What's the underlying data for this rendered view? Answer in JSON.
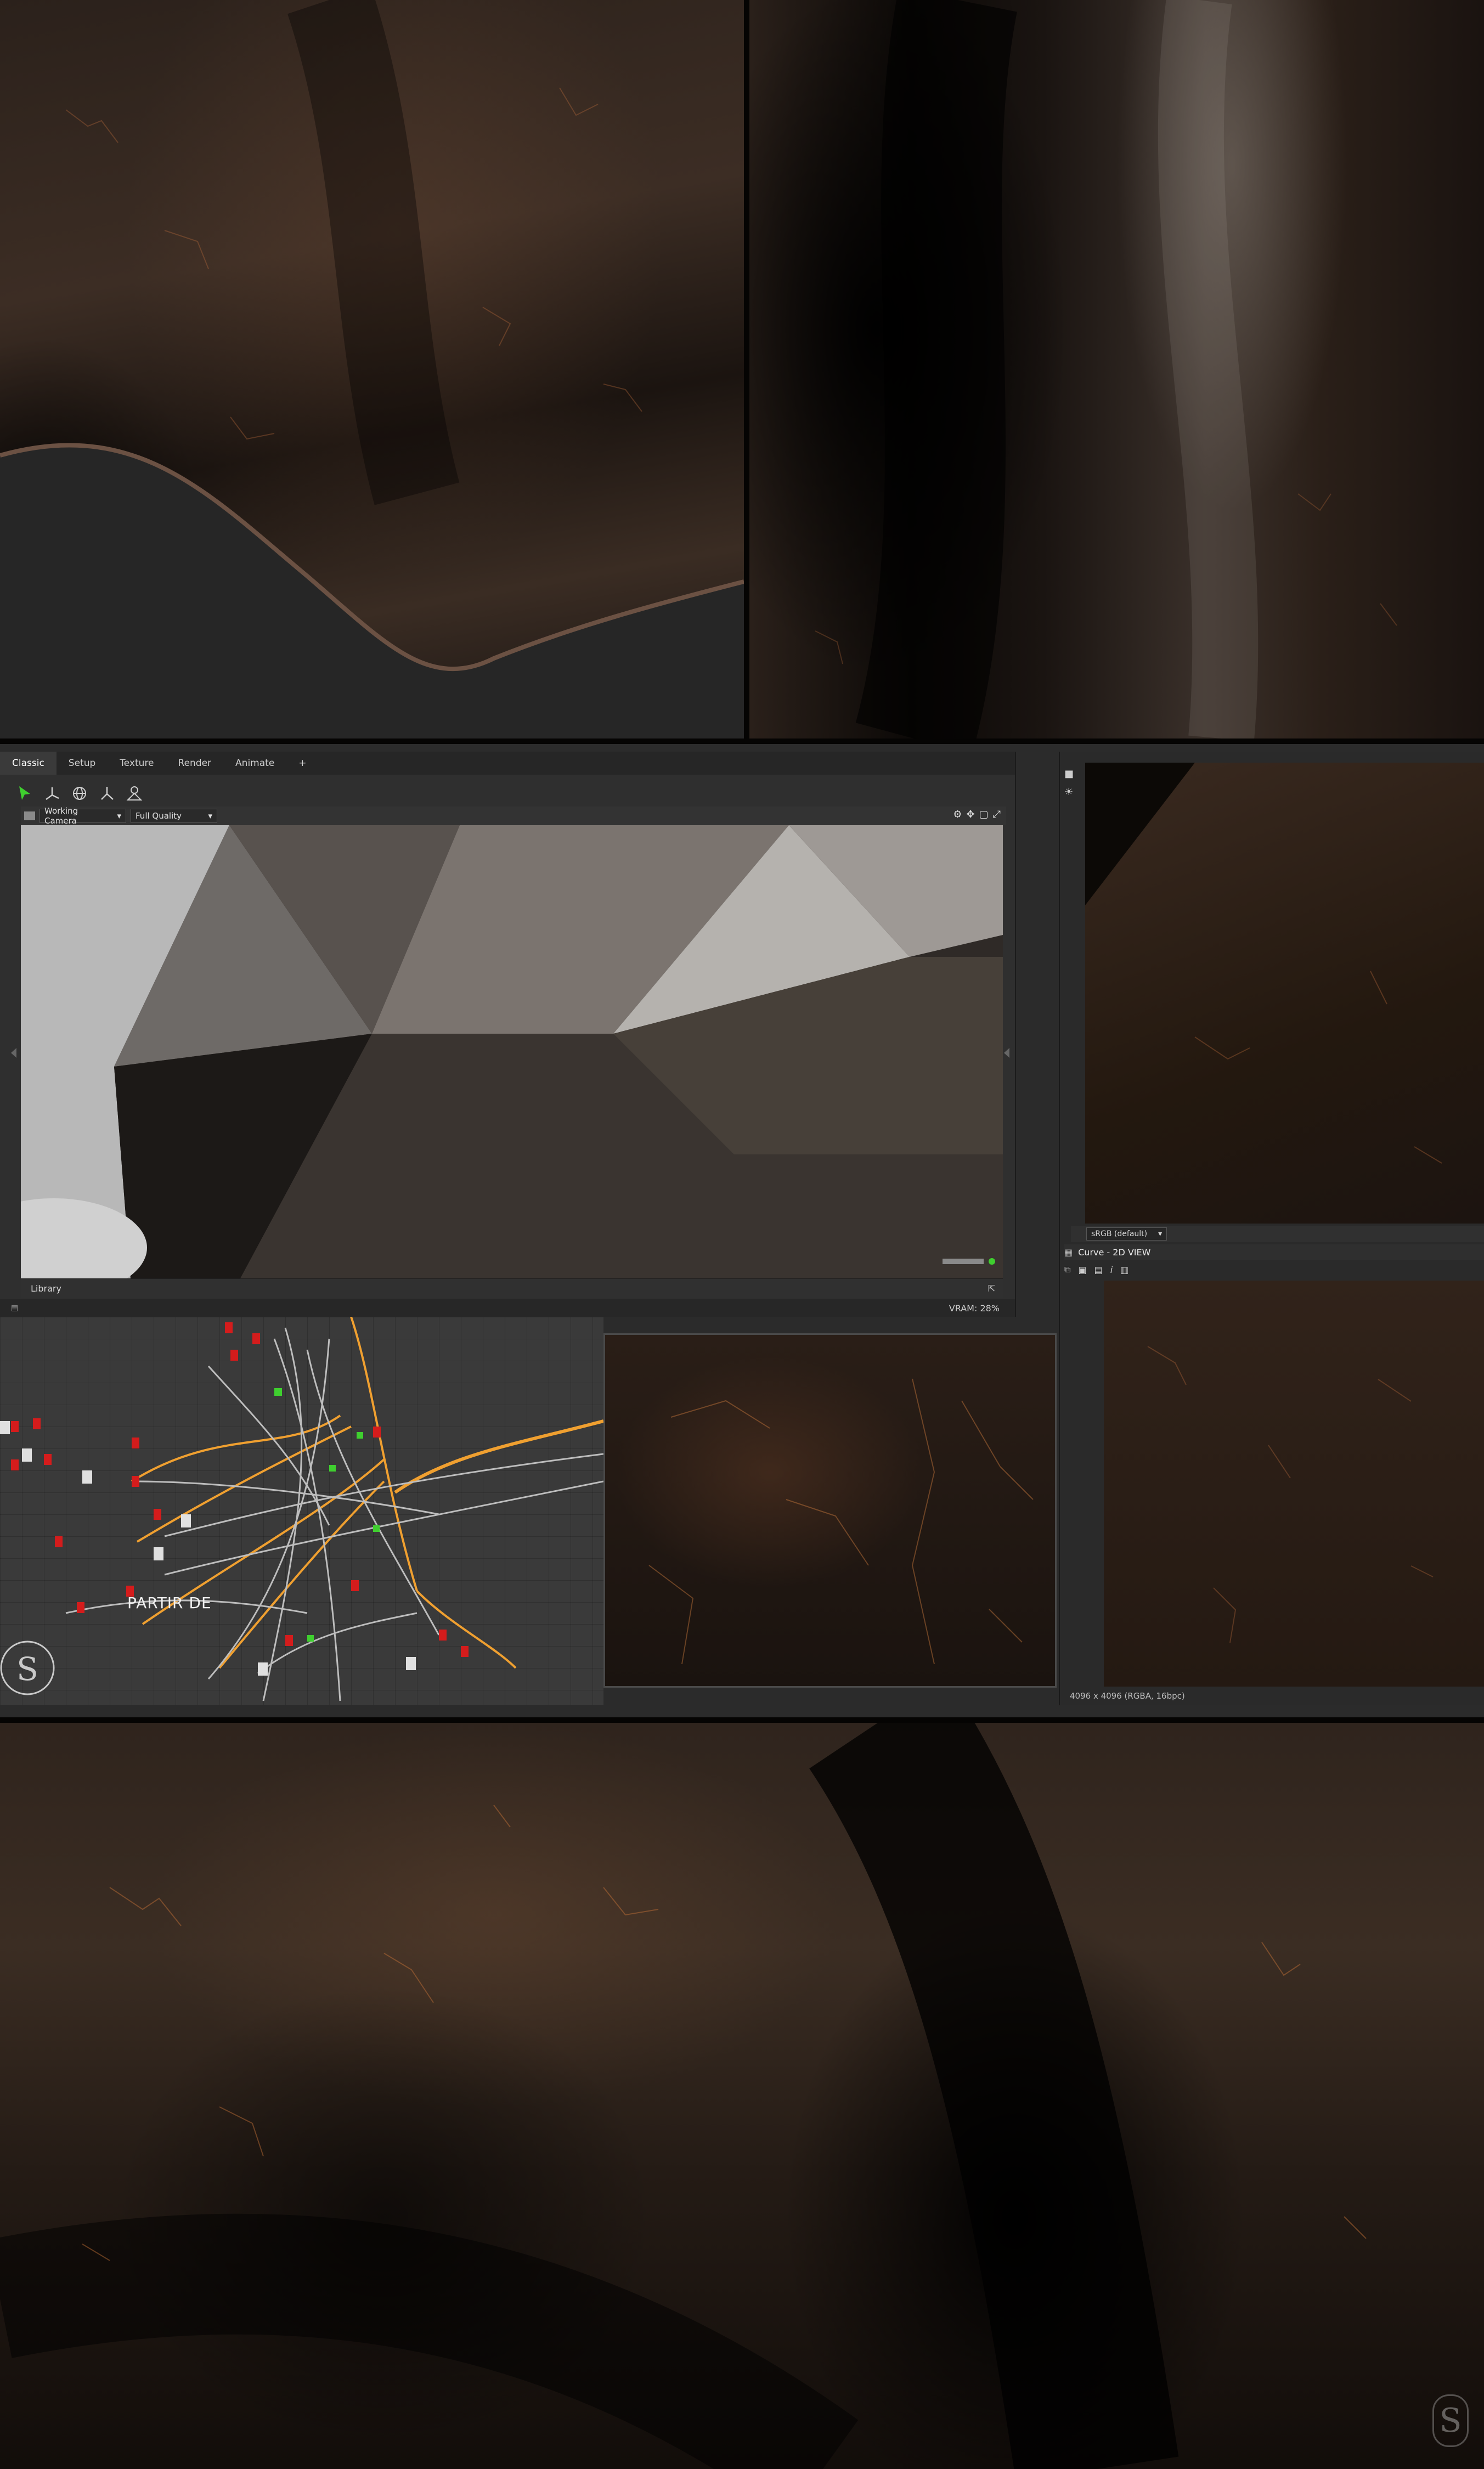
{
  "tabs": [
    "Classic",
    "Setup",
    "Texture",
    "Render",
    "Animate",
    "+"
  ],
  "active_tab": "Classic",
  "viewport": {
    "camera_select": "Working Camera",
    "quality_select": "Full Quality",
    "library_label": "Library",
    "vram": "VRAM: 28%"
  },
  "graph": {
    "label": "PARTIR DE"
  },
  "right_panel": {
    "colorspace": "sRGB (default)",
    "view2d_title": "Curve - 2D VIEW",
    "resolution": "4096 x 4096 (RGBA, 16bpc)"
  },
  "toolbar_icons": [
    "select-arrow-icon",
    "transform-axes-icon",
    "globe-icon",
    "axis-gizmo-icon",
    "camera-rig-icon"
  ],
  "colors": {
    "accent_green": "#3fcf2f",
    "wire_orange": "#f0a030",
    "wire_gray": "#bdbdbd",
    "node_red": "#d41c1c",
    "panel_bg": "#2f2f2f",
    "leather_brown": "#3b2d23"
  }
}
